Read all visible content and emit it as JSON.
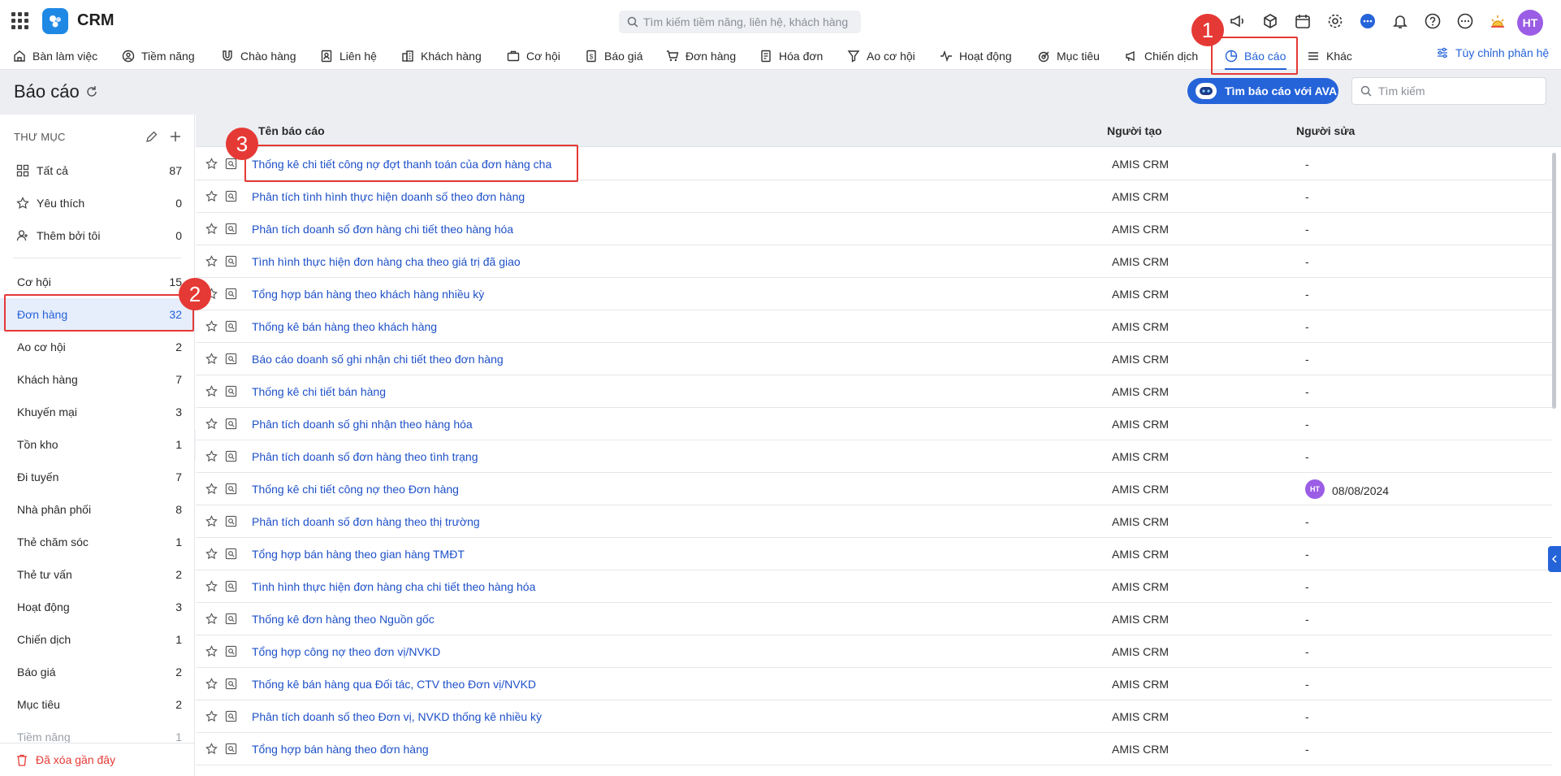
{
  "app": {
    "title": "CRM"
  },
  "search": {
    "placeholder": "Tìm kiếm tiềm năng, liên hệ, khách hàng"
  },
  "user": {
    "initials": "HT"
  },
  "nav": {
    "items": [
      {
        "label": "Bàn làm việc",
        "icon": "home-icon"
      },
      {
        "label": "Tiềm năng",
        "icon": "lead-icon"
      },
      {
        "label": "Chào hàng",
        "icon": "magnet-icon"
      },
      {
        "label": "Liên hệ",
        "icon": "contact-icon"
      },
      {
        "label": "Khách hàng",
        "icon": "building-icon"
      },
      {
        "label": "Cơ hội",
        "icon": "briefcase-icon"
      },
      {
        "label": "Báo giá",
        "icon": "quote-icon"
      },
      {
        "label": "Đơn hàng",
        "icon": "cart-icon"
      },
      {
        "label": "Hóa đơn",
        "icon": "invoice-icon"
      },
      {
        "label": "Ao cơ hội",
        "icon": "funnel-icon"
      },
      {
        "label": "Hoạt động",
        "icon": "activity-icon"
      },
      {
        "label": "Mục tiêu",
        "icon": "target-icon"
      },
      {
        "label": "Chiến dịch",
        "icon": "megaphone-icon"
      },
      {
        "label": "Báo cáo",
        "icon": "pie-chart-icon"
      },
      {
        "label": "Khác",
        "icon": "menu-icon"
      }
    ],
    "customize_label": "Tùy chỉnh phân hệ"
  },
  "page": {
    "title": "Báo cáo",
    "ava_button": "Tìm báo cáo với AVA",
    "search_placeholder": "Tìm kiếm"
  },
  "sidebar": {
    "heading": "THƯ MỤC",
    "top_items": [
      {
        "label": "Tất cả",
        "count": "87",
        "icon": "grid-icon"
      },
      {
        "label": "Yêu thích",
        "count": "0",
        "icon": "star-icon"
      },
      {
        "label": "Thêm bởi tôi",
        "count": "0",
        "icon": "user-icon"
      }
    ],
    "folders": [
      {
        "label": "Cơ hội",
        "count": "15"
      },
      {
        "label": "Đơn hàng",
        "count": "32"
      },
      {
        "label": "Ao cơ hội",
        "count": "2"
      },
      {
        "label": "Khách hàng",
        "count": "7"
      },
      {
        "label": "Khuyến mại",
        "count": "3"
      },
      {
        "label": "Tồn kho",
        "count": "1"
      },
      {
        "label": "Đi tuyến",
        "count": "7"
      },
      {
        "label": "Nhà phân phối",
        "count": "8"
      },
      {
        "label": "Thẻ chăm sóc",
        "count": "1"
      },
      {
        "label": "Thẻ tư vấn",
        "count": "2"
      },
      {
        "label": "Hoạt động",
        "count": "3"
      },
      {
        "label": "Chiến dịch",
        "count": "1"
      },
      {
        "label": "Báo giá",
        "count": "2"
      },
      {
        "label": "Mục tiêu",
        "count": "2"
      },
      {
        "label": "Tiềm năng",
        "count": "1"
      }
    ],
    "trash_label": "Đã xóa gần đây"
  },
  "table": {
    "columns": {
      "name": "Tên báo cáo",
      "creator": "Người tạo",
      "editor": "Người sửa"
    },
    "rows": [
      {
        "name": "Thống kê chi tiết công nợ đợt thanh toán của đơn hàng cha",
        "creator": "AMIS CRM",
        "editor": "-"
      },
      {
        "name": "Phân tích tình hình thực hiện doanh số theo đơn hàng",
        "creator": "AMIS CRM",
        "editor": "-"
      },
      {
        "name": "Phân tích doanh số đơn hàng chi tiết theo hàng hóa",
        "creator": "AMIS CRM",
        "editor": "-"
      },
      {
        "name": "Tình hình thực hiện đơn hàng cha theo giá trị đã giao",
        "creator": "AMIS CRM",
        "editor": "-"
      },
      {
        "name": "Tổng hợp bán hàng theo khách hàng nhiều kỳ",
        "creator": "AMIS CRM",
        "editor": "-"
      },
      {
        "name": "Thống kê bán hàng theo khách hàng",
        "creator": "AMIS CRM",
        "editor": "-"
      },
      {
        "name": "Báo cáo doanh số ghi nhận chi tiết theo đơn hàng",
        "creator": "AMIS CRM",
        "editor": "-"
      },
      {
        "name": "Thống kê chi tiết bán hàng",
        "creator": "AMIS CRM",
        "editor": "-"
      },
      {
        "name": "Phân tích doanh số ghi nhận theo hàng hóa",
        "creator": "AMIS CRM",
        "editor": "-"
      },
      {
        "name": "Phân tích doanh số đơn hàng theo tình trạng",
        "creator": "AMIS CRM",
        "editor": "-"
      },
      {
        "name": "Thống kê chi tiết công nợ theo Đơn hàng",
        "creator": "AMIS CRM",
        "editor": "08/08/2024",
        "editor_initials": "HT"
      },
      {
        "name": "Phân tích doanh số đơn hàng theo thị trường",
        "creator": "AMIS CRM",
        "editor": "-"
      },
      {
        "name": "Tổng hợp bán hàng theo gian hàng TMĐT",
        "creator": "AMIS CRM",
        "editor": "-"
      },
      {
        "name": "Tình hình thực hiện đơn hàng cha chi tiết theo hàng hóa",
        "creator": "AMIS CRM",
        "editor": "-"
      },
      {
        "name": "Thống kê đơn hàng theo Nguồn gốc",
        "creator": "AMIS CRM",
        "editor": "-"
      },
      {
        "name": "Tổng hợp công nợ theo đơn vị/NVKD",
        "creator": "AMIS CRM",
        "editor": "-"
      },
      {
        "name": "Thống kê bán hàng qua Đối tác, CTV theo Đơn vị/NVKD",
        "creator": "AMIS CRM",
        "editor": "-"
      },
      {
        "name": "Phân tích doanh số theo Đơn vị, NVKD thống kê nhiều kỳ",
        "creator": "AMIS CRM",
        "editor": "-"
      },
      {
        "name": "Tổng hợp bán hàng theo đơn hàng",
        "creator": "AMIS CRM",
        "editor": "-"
      }
    ]
  },
  "annotations": {
    "badge1": "1",
    "badge2": "2",
    "badge3": "3"
  },
  "colors": {
    "accent": "#2563d9",
    "annotation": "#e53935",
    "avatar": "#9b5de5"
  }
}
